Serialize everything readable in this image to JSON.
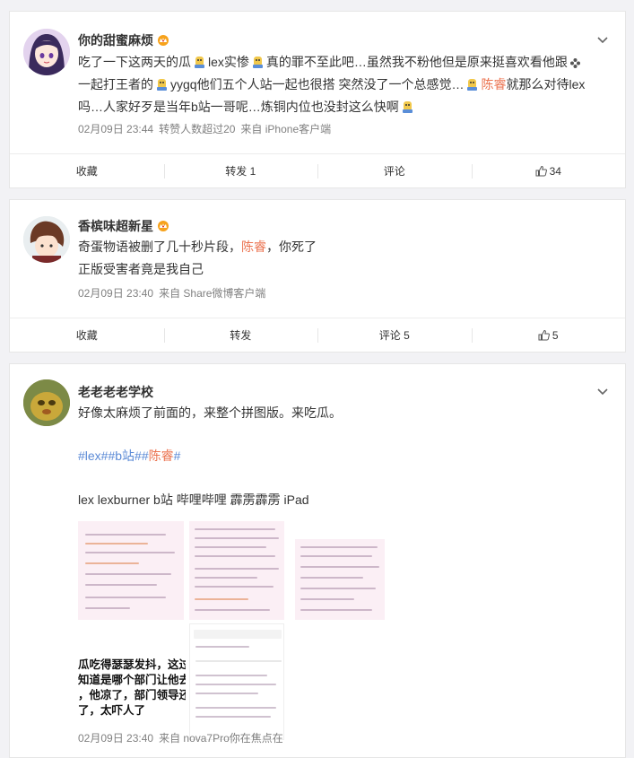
{
  "posts": [
    {
      "username": "你的甜蜜麻烦",
      "body_parts": [
        "吃了一下这两天的瓜",
        "lex实惨",
        "真的罪不至此吧…虽然我不粉他但是原来挺喜欢看他跟",
        "一起打王者的",
        "yygq他们五个人站一起也很搭 突然没了一个总感觉…",
        "陈睿",
        "就那么对待lex吗…人家好歹是当年b站一哥呢…炼铜内位也没封这么快啊"
      ],
      "meta": [
        "02月09日 23:44",
        "转赞人数超过20",
        "来自 iPhone客户端"
      ],
      "actions": [
        "收藏",
        "转发 1",
        "评论",
        "34"
      ]
    },
    {
      "username": "香槟味超新星",
      "body_line1_a": "奇蛋物语被删了几十秒片段，",
      "body_line1_hl": "陈睿",
      "body_line1_b": "，你死了",
      "body_line2": "正版受害者竟是我自己",
      "meta": [
        "02月09日 23:40",
        "来自 Share微博客户端"
      ],
      "actions": [
        "收藏",
        "转发",
        "评论 5",
        "5"
      ]
    },
    {
      "username": "老老老老学校",
      "body_line1": "好像太麻烦了前面的，来整个拼图版。来吃瓜。",
      "tags": [
        "#lex#",
        "#b站#",
        "#",
        "陈睿",
        "#"
      ],
      "keywords": "lex lexburner b站 哔哩哔哩 霹雳霹雳 iPad",
      "image_text": [
        "瓜吃得瑟瑟发抖，这过",
        "知道是哪个部门让他去",
        "，他凉了，部门领导还",
        "了，太吓人了"
      ],
      "meta": [
        "02月09日 23:40",
        "来自 nova7Pro你在焦点在"
      ]
    }
  ],
  "colors": {
    "link": "#5b8ad6",
    "highlight": "#eb7350",
    "meta": "#808080",
    "background": "#f2f2f5"
  }
}
